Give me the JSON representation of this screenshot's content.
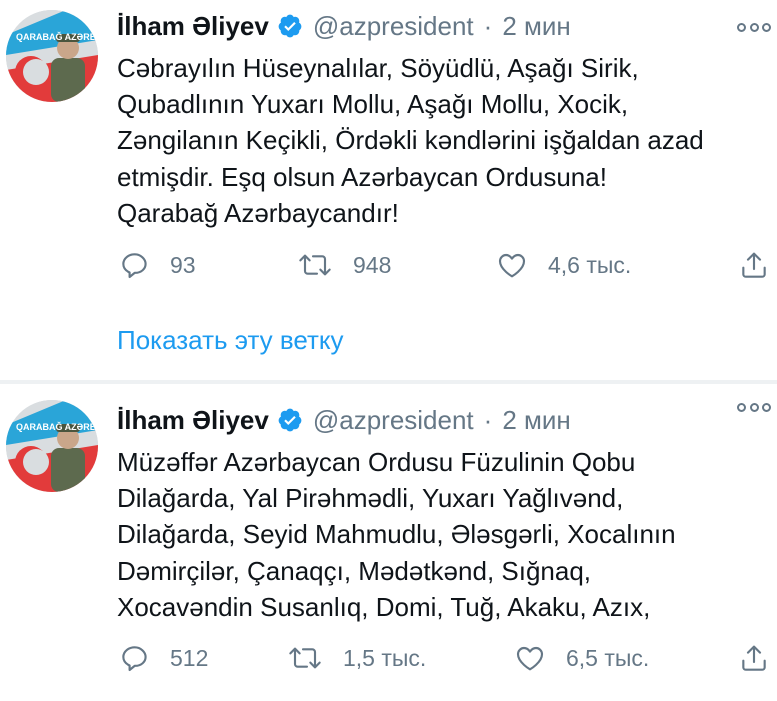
{
  "tweets": [
    {
      "author_name": "İlham Əliyev",
      "handle": "@azpresident",
      "separator": "·",
      "time": "2 мин",
      "avatar_caption": "QARABAĞ AZƏRBAYCANDIR",
      "lines": [
        "Cəbrayılın Hüseynalılar, Söyüdlü, Aşağı Sirik,",
        "Qubadlının Yuxarı Mollu, Aşağı Mollu, Xocik,",
        "Zəngilanın Keçikli, Ördəkli kəndlərini işğaldan azad",
        "etmişdir. Eşq olsun Azərbaycan Ordusuna!",
        "Qarabağ Azərbaycandır!"
      ],
      "replies": "93",
      "retweets": "948",
      "likes": "4,6 тыс.",
      "show_thread": "Показать эту ветку"
    },
    {
      "author_name": "İlham Əliyev",
      "handle": "@azpresident",
      "separator": "·",
      "time": "2 мин",
      "avatar_caption": "QARABAĞ AZƏRBAYCANDIR",
      "lines": [
        "Müzəffər Azərbaycan Ordusu Füzulinin Qobu",
        "Dilağarda, Yal Pirəhmədli, Yuxarı Yağlıvənd,",
        "Dilağarda, Seyid Mahmudlu, Ələsgərli, Xocalının",
        "Dəmirçilər, Çanaqçı, Mədətkənd, Sığnaq,",
        "Xocavəndin Susanlıq, Domi, Tuğ, Akaku, Azıx,"
      ],
      "replies": "512",
      "retweets": "1,5 тыс.",
      "likes": "6,5 тыс."
    }
  ],
  "icons": {
    "verified": "verified-badge-icon",
    "more": "more-options-icon",
    "reply": "reply-icon",
    "retweet": "retweet-icon",
    "like": "like-icon",
    "share": "share-icon"
  },
  "colors": {
    "accent": "#1d9bf0",
    "secondary_text": "#657786",
    "primary_text": "#0f1419",
    "separator": "#eef1f3"
  }
}
